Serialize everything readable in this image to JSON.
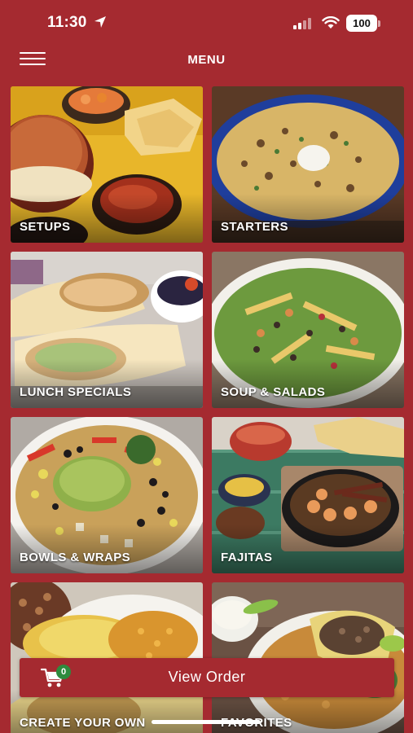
{
  "status": {
    "time": "11:30",
    "battery": "100"
  },
  "header": {
    "title": "MENU"
  },
  "tiles": [
    {
      "label": "SETUPS"
    },
    {
      "label": "STARTERS"
    },
    {
      "label": "LUNCH SPECIALS"
    },
    {
      "label": "SOUP & SALADS"
    },
    {
      "label": "BOWLS & WRAPS"
    },
    {
      "label": "FAJITAS"
    },
    {
      "label": "CREATE YOUR OWN"
    },
    {
      "label": "FAVORITES"
    }
  ],
  "order": {
    "label": "View Order",
    "count": "0"
  },
  "colors": {
    "brand": "#a52a30",
    "badge": "#2e8b3e"
  }
}
